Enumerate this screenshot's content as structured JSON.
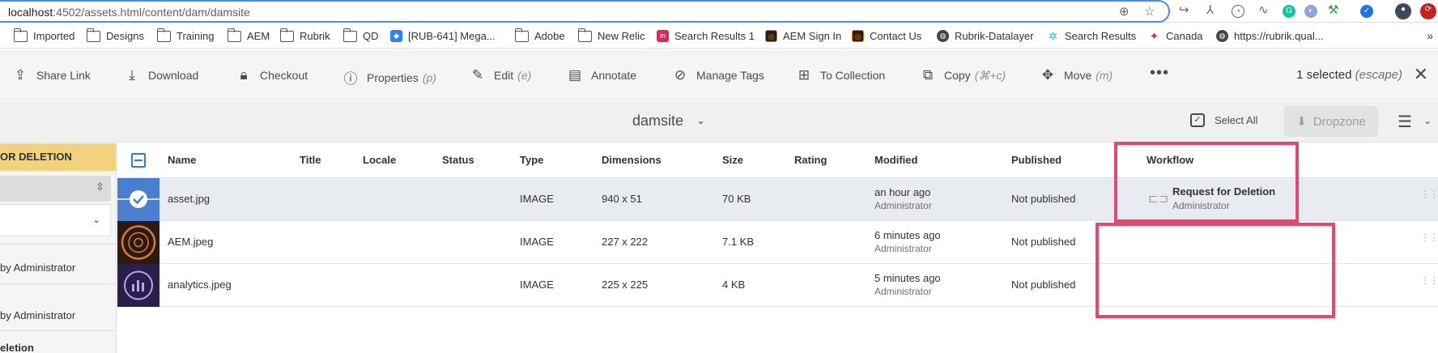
{
  "browser": {
    "url_host": "localhost",
    "url_rest": ":4502/assets.html/content/dam/damsite"
  },
  "bookmarks": [
    {
      "label": "Imported",
      "icon": "folder-icon"
    },
    {
      "label": "Designs",
      "icon": "folder-icon"
    },
    {
      "label": "Training",
      "icon": "folder-icon"
    },
    {
      "label": "AEM",
      "icon": "folder-icon"
    },
    {
      "label": "Rubrik",
      "icon": "folder-icon"
    },
    {
      "label": "QD",
      "icon": "folder-icon"
    },
    {
      "label": "[RUB-641] Mega...",
      "icon": "jira-icon"
    },
    {
      "label": "Adobe",
      "icon": "folder-icon"
    },
    {
      "label": "New Relic",
      "icon": "folder-icon"
    },
    {
      "label": "Search Results 1",
      "icon": "invision-icon"
    },
    {
      "label": "AEM Sign In",
      "icon": "aem-icon"
    },
    {
      "label": "Contact Us",
      "icon": "aem-icon"
    },
    {
      "label": "Rubrik-Datalayer",
      "icon": "globe-icon"
    },
    {
      "label": "Search Results",
      "icon": "gear-icon"
    },
    {
      "label": "Canada",
      "icon": "maple-leaf-icon"
    },
    {
      "label": "https://rubrik.qual...",
      "icon": "globe-icon"
    }
  ],
  "actions": [
    {
      "label": "Share Link",
      "shortcut": "",
      "icon": "share-icon"
    },
    {
      "label": "Download",
      "shortcut": "",
      "icon": "download-icon"
    },
    {
      "label": "Checkout",
      "shortcut": "",
      "icon": "lock-icon"
    },
    {
      "label": "Properties",
      "shortcut": "(p)",
      "icon": "info-icon"
    },
    {
      "label": "Edit",
      "shortcut": "(e)",
      "icon": "pencil-icon"
    },
    {
      "label": "Annotate",
      "shortcut": "",
      "icon": "comment-icon"
    },
    {
      "label": "Manage Tags",
      "shortcut": "",
      "icon": "tag-icon"
    },
    {
      "label": "To Collection",
      "shortcut": "",
      "icon": "collection-icon"
    },
    {
      "label": "Copy",
      "shortcut": "(⌘+c)",
      "icon": "copy-icon"
    },
    {
      "label": "Move",
      "shortcut": "(m)",
      "icon": "move-icon"
    }
  ],
  "selection": {
    "count_label": "1 selected",
    "escape_label": "(escape)"
  },
  "title_bar": {
    "folder": "damsite",
    "select_all": "Select All",
    "dropzone": "Dropzone"
  },
  "left_panel": {
    "header": "OR DELETION",
    "entry1": "by Administrator",
    "entry2": "by Administrator",
    "entry3": "eletion"
  },
  "columns": {
    "name": "Name",
    "title": "Title",
    "locale": "Locale",
    "status": "Status",
    "type": "Type",
    "dimensions": "Dimensions",
    "size": "Size",
    "rating": "Rating",
    "modified": "Modified",
    "published": "Published",
    "workflow": "Workflow"
  },
  "rows": [
    {
      "name": "asset.jpg",
      "type": "IMAGE",
      "dimensions": "940 x 51",
      "size": "70 KB",
      "modified": "an hour ago",
      "modified_by": "Administrator",
      "published": "Not published",
      "workflow": "Request for Deletion",
      "workflow_by": "Administrator",
      "selected": true
    },
    {
      "name": "AEM.jpeg",
      "type": "IMAGE",
      "dimensions": "227 x 222",
      "size": "7.1 KB",
      "modified": "6 minutes ago",
      "modified_by": "Administrator",
      "published": "Not published",
      "workflow": "",
      "workflow_by": "",
      "selected": false
    },
    {
      "name": "analytics.jpeg",
      "type": "IMAGE",
      "dimensions": "225 x 225",
      "size": "4 KB",
      "modified": "5 minutes ago",
      "modified_by": "Administrator",
      "published": "Not published",
      "workflow": "",
      "workflow_by": "",
      "selected": false
    }
  ],
  "colors": {
    "highlight": "#e8466e",
    "accent": "#2680eb",
    "panel_header": "#f3d27f"
  }
}
